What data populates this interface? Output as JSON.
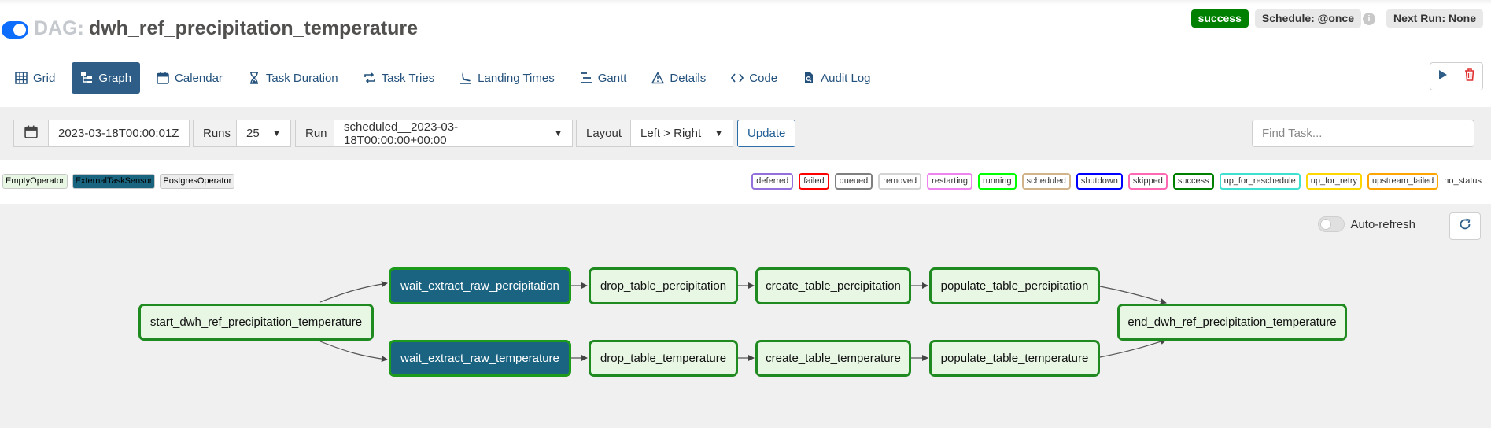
{
  "header": {
    "dag_prefix": "DAG:",
    "dag_name": "dwh_ref_precipitation_temperature",
    "status_badge": "success",
    "schedule": "Schedule: @once",
    "next_run": "Next Run: None",
    "info_icon": "i"
  },
  "tabs": [
    {
      "label": "Grid",
      "icon": "grid-icon"
    },
    {
      "label": "Graph",
      "icon": "graph-icon",
      "active": true
    },
    {
      "label": "Calendar",
      "icon": "calendar-icon"
    },
    {
      "label": "Task Duration",
      "icon": "hourglass-icon"
    },
    {
      "label": "Task Tries",
      "icon": "repeat-icon"
    },
    {
      "label": "Landing Times",
      "icon": "landing-icon"
    },
    {
      "label": "Gantt",
      "icon": "gantt-icon"
    },
    {
      "label": "Details",
      "icon": "warning-icon"
    },
    {
      "label": "Code",
      "icon": "code-icon"
    },
    {
      "label": "Audit Log",
      "icon": "audit-icon"
    }
  ],
  "filters": {
    "date": "2023-03-18T00:00:01Z",
    "runs_label": "Runs",
    "runs_value": "25",
    "run_label": "Run",
    "run_value": "scheduled__2023-03-18T00:00:00+00:00",
    "layout_label": "Layout",
    "layout_value": "Left > Right",
    "update": "Update",
    "find_placeholder": "Find Task..."
  },
  "operators": [
    {
      "label": "EmptyOperator",
      "color": "#e8f7e4"
    },
    {
      "label": "ExternalTaskSensor",
      "color": "#19647e"
    },
    {
      "label": "PostgresOperator",
      "color": "#ededed"
    }
  ],
  "states": [
    {
      "label": "deferred",
      "color": "#9370db"
    },
    {
      "label": "failed",
      "color": "#ff0000"
    },
    {
      "label": "queued",
      "color": "#808080"
    },
    {
      "label": "removed",
      "color": "#d3d3d3"
    },
    {
      "label": "restarting",
      "color": "#ee82ee"
    },
    {
      "label": "running",
      "color": "#00ff00"
    },
    {
      "label": "scheduled",
      "color": "#d2b48c"
    },
    {
      "label": "shutdown",
      "color": "#0000ff"
    },
    {
      "label": "skipped",
      "color": "#ff69b4"
    },
    {
      "label": "success",
      "color": "#008000"
    },
    {
      "label": "up_for_reschedule",
      "color": "#40e0d0"
    },
    {
      "label": "up_for_retry",
      "color": "#ffd700"
    },
    {
      "label": "upstream_failed",
      "color": "#ffa500"
    },
    {
      "label": "no_status",
      "color": "none"
    }
  ],
  "graph": {
    "auto_refresh": "Auto-refresh",
    "nodes": {
      "start": "start_dwh_ref_precipitation_temperature",
      "wait_p": "wait_extract_raw_percipitation",
      "wait_t": "wait_extract_raw_temperature",
      "drop_p": "drop_table_percipitation",
      "drop_t": "drop_table_temperature",
      "create_p": "create_table_percipitation",
      "create_t": "create_table_temperature",
      "populate_p": "populate_table_percipitation",
      "populate_t": "populate_table_temperature",
      "end": "end_dwh_ref_precipitation_temperature"
    }
  }
}
